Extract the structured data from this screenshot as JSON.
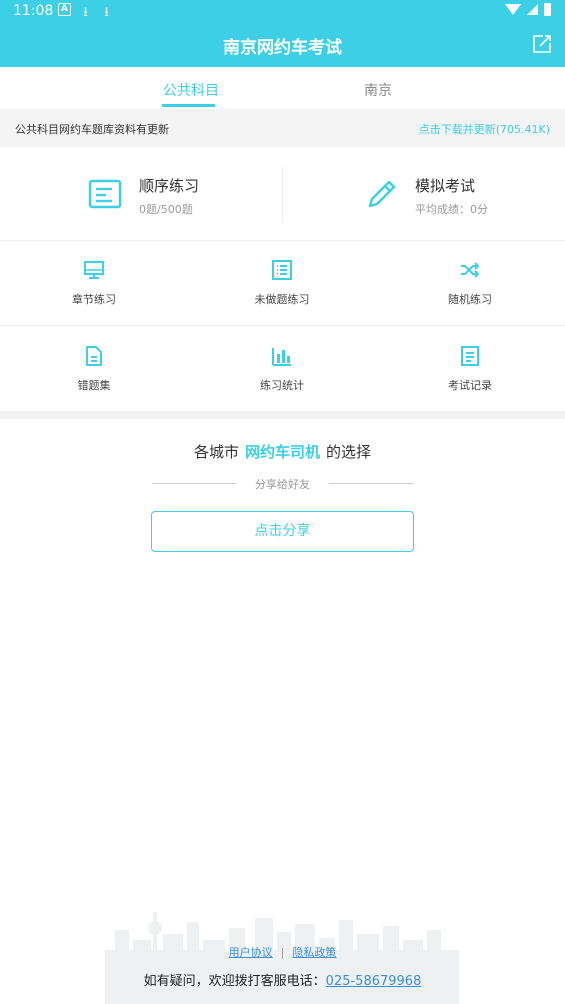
{
  "status_bar": {
    "time": "11:08"
  },
  "header": {
    "title": "南京网约车考试",
    "edit_icon": "edit-share-icon"
  },
  "tabs": [
    {
      "label": "公共科目",
      "active": true
    },
    {
      "label": "南京",
      "active": false
    }
  ],
  "notice": {
    "text": "公共科目网约车题库资料有更新",
    "link": "点击下载并更新(705.41K)"
  },
  "main_actions": [
    {
      "title": "顺序练习",
      "subtitle": "0题/500题",
      "icon": "document-list-icon"
    },
    {
      "title": "模拟考试",
      "subtitle": "平均成绩：0分",
      "icon": "pencil-icon"
    }
  ],
  "grid": [
    {
      "label": "章节练习",
      "icon": "monitor-icon"
    },
    {
      "label": "未做题练习",
      "icon": "list-icon"
    },
    {
      "label": "随机练习",
      "icon": "shuffle-icon"
    },
    {
      "label": "错题集",
      "icon": "file-icon"
    },
    {
      "label": "练习统计",
      "icon": "bar-chart-icon"
    },
    {
      "label": "考试记录",
      "icon": "record-icon"
    }
  ],
  "share": {
    "prefix": "各城市",
    "highlight": "网约车司机",
    "suffix": "的选择",
    "sub": "分享给好友",
    "button": "点击分享"
  },
  "footer": {
    "user_agreement": "用户协议",
    "separator": "|",
    "privacy": "隐私政策",
    "contact_prefix": "如有疑问，欢迎拨打客服电话：",
    "phone": "025-58679968"
  },
  "colors": {
    "accent": "#3ccfe6",
    "link": "#3a8fd6"
  }
}
